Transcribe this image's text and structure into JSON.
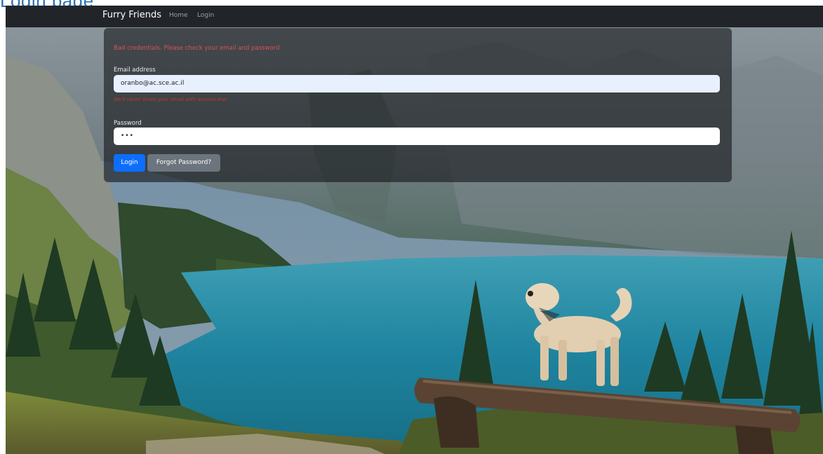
{
  "doc": {
    "heading": "Login page"
  },
  "navbar": {
    "brand": "Furry Friends",
    "links": [
      "Home",
      "Login"
    ]
  },
  "login_form": {
    "alert": "Bad credentials. Please check your email and password",
    "email_label": "Email address",
    "email_value": "oranbo@ac.sce.ac.il",
    "email_error": "We'll never share your email with anyone else.",
    "password_label": "Password",
    "password_value": "•••",
    "login_button": "Login",
    "forgot_button": "Forgot Password?"
  },
  "colors": {
    "navbar": "#212529",
    "primary": "#0d6efd",
    "secondary": "#6c757d",
    "danger": "#d9534f"
  },
  "background": {
    "description_icon": "mountain-lake-dog-image"
  }
}
